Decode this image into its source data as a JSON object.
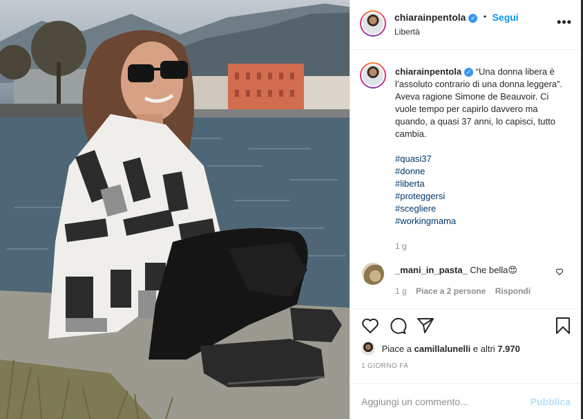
{
  "post": {
    "username": "chiarainpentola",
    "follow_label": "Segui",
    "location": "Libertà",
    "more_label": "•••",
    "caption": "“Una donna libera è l’assoluto contrario di una donna leggera”. Aveva ragione Simone de Beauvoir. Ci vuole tempo per capirlo davvero ma quando, a quasi 37 anni, lo capisci, tutto cambia.",
    "hashtags": [
      "#quasi37",
      "#donne",
      "#liberta",
      "#proteggersi",
      "#scegliere",
      "#workingmama"
    ],
    "caption_time": "1 g"
  },
  "comment": {
    "username": "_mani_in_pasta_",
    "text": "Che bella😍",
    "time": "1 g",
    "likes": "Piace a 2 persone",
    "reply": "Rispondi"
  },
  "actions": {
    "likes_prefix": "Piace a",
    "likes_user": "camillalunelli",
    "likes_suffix": "e altri",
    "likes_count": "7.970",
    "posted_ago": "1 GIORNO FA"
  },
  "composer": {
    "placeholder": "Aggiungi un commento...",
    "publish_label": "Pubblica"
  },
  "colors": {
    "accent": "#0095f6",
    "hashtag": "#00376b",
    "muted": "#8e8e8e",
    "publish_disabled": "#b2dffc"
  }
}
